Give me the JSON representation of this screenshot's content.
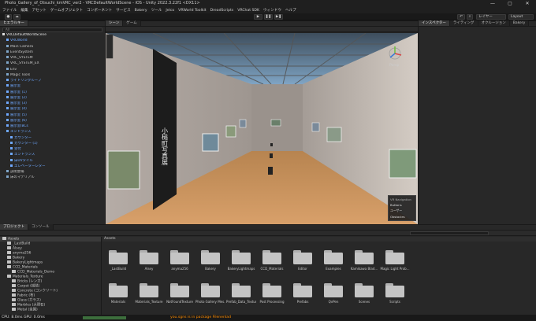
{
  "window": {
    "title": "Photo_Gallery_of_Otsuchi_kmVRC_ver2 - VRCDefaultWorldScene - iOS - Unity 2022.3.22f1 <DX11>"
  },
  "window_controls": {
    "minimize": "—",
    "maximize": "▢",
    "close": "✕"
  },
  "menu": [
    "ファイル",
    "編集",
    "アセット",
    "ゲームオブジェクト",
    "コンポーネント",
    "サービス",
    "Bakery",
    "ツール",
    "Jelco",
    "VRWorld Toolkit",
    "DreadScripts",
    "VRChat SDK",
    "ウィンドウ",
    "ヘルプ"
  ],
  "toolbar": {
    "play": "▶",
    "pause": "❚❚",
    "step": "▶❚",
    "layers": "レイヤー",
    "layout": "Layout"
  },
  "hierarchy": {
    "tab": "ヒエラルキー",
    "search_placeholder": "All",
    "items": [
      {
        "label": "VRCDefaultWorldScene",
        "indent": 0,
        "kind": "scene"
      },
      {
        "label": "VRCWorld",
        "indent": 1,
        "kind": "prefab"
      },
      {
        "label": "Main Camera",
        "indent": 1,
        "kind": "normal"
      },
      {
        "label": "EventSystem",
        "indent": 1,
        "kind": "normal"
      },
      {
        "label": "VRC_SYSTEM",
        "indent": 1,
        "kind": "normal"
      },
      {
        "label": "VRC_SYSTEM_EX",
        "indent": 1,
        "kind": "normal"
      },
      {
        "label": "Env",
        "indent": 1,
        "kind": "normal"
      },
      {
        "label": "Magic Tools",
        "indent": 1,
        "kind": "normal"
      },
      {
        "label": "ライトリングループ",
        "indent": 1,
        "kind": "prefab"
      },
      {
        "label": "展示室",
        "indent": 1,
        "kind": "prefab"
      },
      {
        "label": "展示室 (1)",
        "indent": 1,
        "kind": "prefab"
      },
      {
        "label": "展示室 (2)",
        "indent": 1,
        "kind": "prefab"
      },
      {
        "label": "展示室 (3)",
        "indent": 1,
        "kind": "prefab"
      },
      {
        "label": "展示室 (4)",
        "indent": 1,
        "kind": "prefab"
      },
      {
        "label": "展示室 (5)",
        "indent": 1,
        "kind": "prefab"
      },
      {
        "label": "展示室 (6)",
        "indent": 1,
        "kind": "prefab"
      },
      {
        "label": "展示室IBCs",
        "indent": 1,
        "kind": "prefab"
      },
      {
        "label": "エントランス",
        "indent": 1,
        "kind": "prefab"
      },
      {
        "label": "カウンター",
        "indent": 2,
        "kind": "prefab"
      },
      {
        "label": "カウンター (1)",
        "indent": 2,
        "kind": "prefab"
      },
      {
        "label": "受付",
        "indent": 2,
        "kind": "prefab"
      },
      {
        "label": "エントランス",
        "indent": 2,
        "kind": "prefab"
      },
      {
        "label": "床UVタイル",
        "indent": 2,
        "kind": "prefab"
      },
      {
        "label": "エレベーターレター",
        "indent": 2,
        "kind": "prefab"
      },
      {
        "label": "説明会場",
        "indent": 1,
        "kind": "normal"
      },
      {
        "label": "床のマテリアル",
        "indent": 1,
        "kind": "normal"
      }
    ]
  },
  "scene_view": {
    "tabs": [
      "シーン",
      "ゲーム"
    ],
    "nav_overlay": {
      "title": "VR Navigation",
      "items": [
        "Buttons",
        "ユーザー",
        "Obstacles"
      ]
    },
    "mode_persp": "Persp",
    "sign_text": "小槌町写真展"
  },
  "inspector": {
    "tabs": [
      "インスペクター",
      "ライティング",
      "オクルージョン"
    ],
    "extra_tab": "Bakery"
  },
  "project": {
    "tabs": [
      "プロジェクト",
      "コンソール"
    ],
    "breadcrumb": "Assets",
    "tree": [
      {
        "label": "Assets",
        "indent": 0,
        "selected": true
      },
      {
        "label": "_LastBuild",
        "indent": 1
      },
      {
        "label": "Alsey",
        "indent": 1
      },
      {
        "label": "anyma256",
        "indent": 1
      },
      {
        "label": "Bakery",
        "indent": 1
      },
      {
        "label": "BakeryLightmaps",
        "indent": 1
      },
      {
        "label": "CCD_Materials",
        "indent": 1
      },
      {
        "label": "CCD_Materials_Demo",
        "indent": 2
      },
      {
        "label": "Materials_Texture",
        "indent": 1
      },
      {
        "label": "Bricks (レンガ)",
        "indent": 2
      },
      {
        "label": "Carpet (絨毯)",
        "indent": 2
      },
      {
        "label": "Concrete (コンクリート)",
        "indent": 2
      },
      {
        "label": "Fabric (布)",
        "indent": 2
      },
      {
        "label": "Glass (ガラス)",
        "indent": 2
      },
      {
        "label": "Marbles (大理石)",
        "indent": 2
      },
      {
        "label": "Metal (金属)",
        "indent": 2
      }
    ],
    "folders_row1": [
      "_LastBuild",
      "Alsey",
      "anyma256",
      "Bakery",
      "BakeryLightmaps",
      "CCD_Materials",
      "Editor",
      "Examples",
      "Kamikawa Blad...",
      "Magic Light Prob..."
    ],
    "folders_row2": [
      "Materials",
      "Materials_Texture",
      "NotFoundTexture",
      "Photo Gallery Mes...",
      "Prefab_Data_Texture",
      "Post Processing",
      "Prefabs",
      "QvPen",
      "Scenes",
      "Scripts"
    ]
  },
  "status": {
    "message": "you.sgns is in package FilenenIad",
    "perf": "CPU: 8.0ms  GPU: 0.0ms"
  },
  "colors": {
    "accent": "#2c5d87",
    "prefab": "#6fa8ff",
    "warning": "#ff8c00"
  }
}
